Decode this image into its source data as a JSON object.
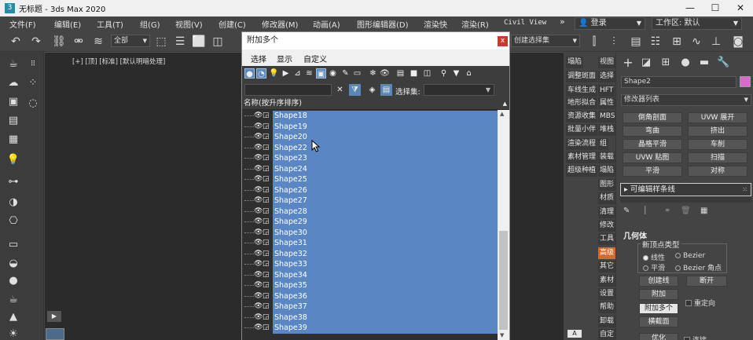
{
  "window": {
    "title": "无标题 - 3ds Max 2020",
    "app_icon": "3ds-max-icon",
    "minimize": "—",
    "maximize": "☐",
    "close": "✕"
  },
  "menubar": {
    "items": [
      "文件(F)",
      "编辑(E)",
      "工具(T)",
      "组(G)",
      "视图(V)",
      "创建(C)",
      "修改器(M)",
      "动画(A)",
      "图形编辑器(D)",
      "渲染快",
      "渲染(R)",
      "Civil View"
    ],
    "more": "»",
    "login": "登录",
    "workspace": "工作区: 默认"
  },
  "toolbar": {
    "filter_select": "全部",
    "named_selection": "创建选择集"
  },
  "viewport": {
    "label": "[+] [顶] [标准] [默认明暗处理]"
  },
  "sidecol": {
    "buttons": [
      {
        "left": "塌陷",
        "right": "视图"
      },
      {
        "left": "调整斑面",
        "right": "选择"
      },
      {
        "left": "车线生成",
        "right": "HFT"
      },
      {
        "left": "地形拟合",
        "right": "属性"
      },
      {
        "left": "资源收集",
        "right": "MBS"
      },
      {
        "left": "批量小伴",
        "right": "堆栈"
      },
      {
        "left": "渲染流程",
        "right": "组"
      },
      {
        "left": "素材管理",
        "right": "装载"
      },
      {
        "left": "超级种植",
        "right": "塌陷"
      },
      {
        "left": "",
        "right": "图形"
      },
      {
        "left": "",
        "right": "材质"
      },
      {
        "left": "",
        "right": "清理"
      },
      {
        "left": "",
        "right": "修改"
      },
      {
        "left": "",
        "right": "工具"
      },
      {
        "left": "",
        "right": "高级"
      },
      {
        "left": "",
        "right": "其它"
      },
      {
        "left": "",
        "right": "素材"
      },
      {
        "left": "",
        "right": "设置"
      },
      {
        "left": "",
        "right": "帮助"
      },
      {
        "left": "",
        "right": "卸载"
      },
      {
        "left": "",
        "right": "自定"
      }
    ],
    "highlight_index": 14,
    "bottom_tag": "A"
  },
  "command_panel": {
    "object_name": "Shape2",
    "modifier_list": "修改器列表",
    "modifier_buttons": [
      "倒角剖面",
      "UVW 展开",
      "弯曲",
      "挤出",
      "晶格平滑",
      "车削",
      "UVW 贴图",
      "扫描",
      "平滑",
      "对称"
    ],
    "stack_item": "可编辑样条线",
    "section_title": "几何体",
    "new_vertex_group": "新顶点类型",
    "vertex_types": [
      "线性",
      "Bezier",
      "平滑",
      "Bezier 角点"
    ],
    "buttons": {
      "create_line": "创建线",
      "break": "断开",
      "attach": "附加",
      "attach_multiple": "附加多个",
      "reorient": "重定向",
      "cross_section": "横截面",
      "optimize": "优化",
      "connect": "连接"
    },
    "accent_color": "#d96ad0"
  },
  "dialog": {
    "title": "附加多个",
    "close_label": "x",
    "menu": [
      "选择",
      "显示",
      "自定义"
    ],
    "selection_set_label": "选择集:",
    "column_header": "名称(按升序排序)",
    "items": [
      "Shape18",
      "Shape19",
      "Shape20",
      "Shape22",
      "Shape23",
      "Shape24",
      "Shape25",
      "Shape26",
      "Shape27",
      "Shape28",
      "Shape29",
      "Shape30",
      "Shape31",
      "Shape32",
      "Shape33",
      "Shape34",
      "Shape35",
      "Shape36",
      "Shape37",
      "Shape38",
      "Shape39"
    ],
    "selection_color": "#5a86c4"
  }
}
